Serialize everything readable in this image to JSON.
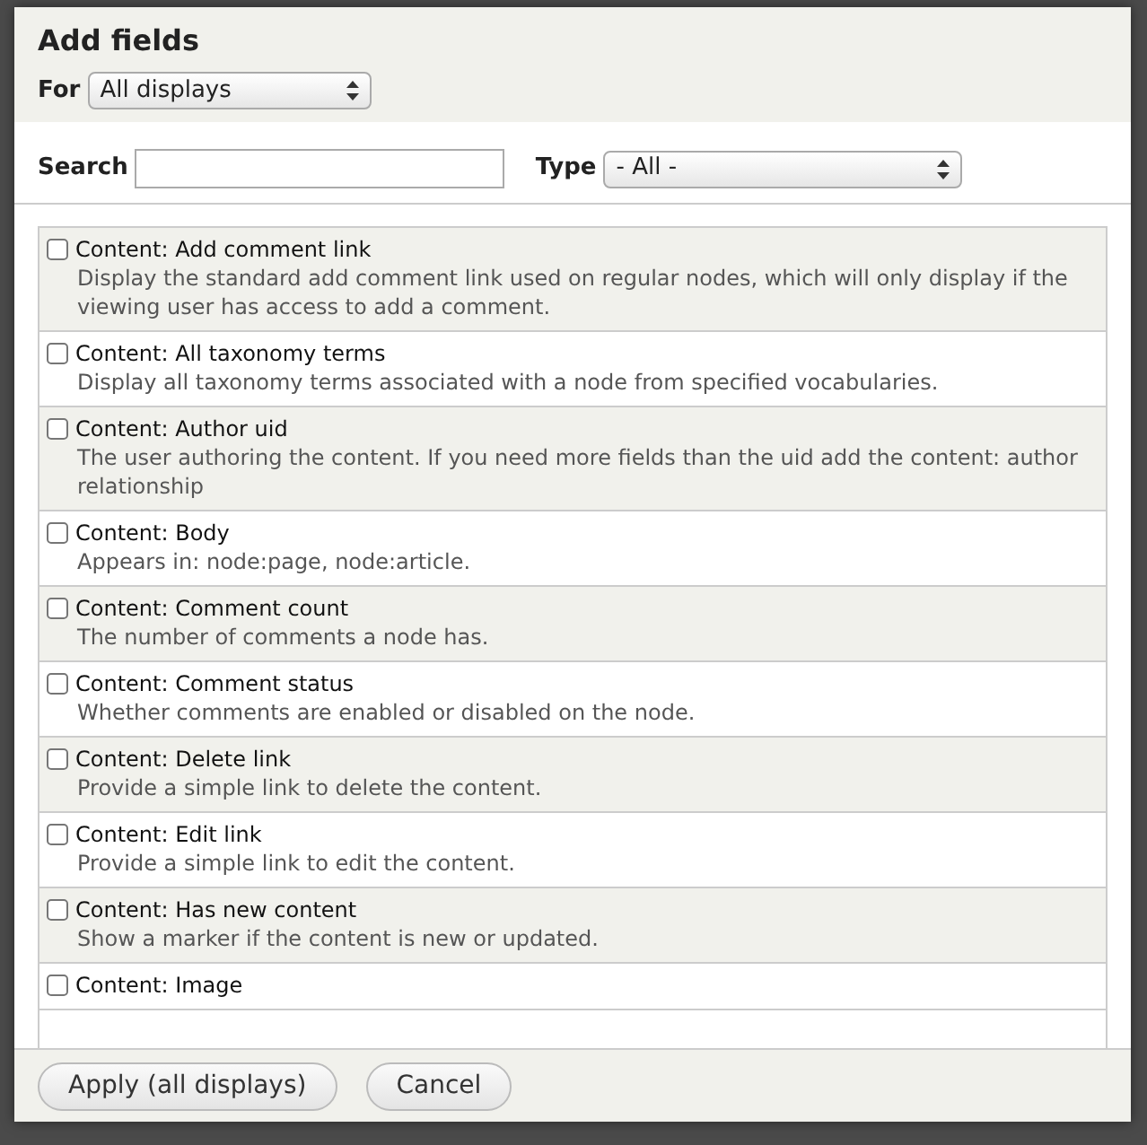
{
  "dialog": {
    "title": "Add fields",
    "for_field": {
      "label": "For",
      "value": "All displays"
    },
    "search_field": {
      "label": "Search"
    },
    "type_field": {
      "label": "Type",
      "value": "- All -"
    },
    "fields": [
      {
        "name": "Content: Add comment link",
        "description": "Display the standard add comment link used on regular nodes, which will only display if the viewing user has access to add a comment.",
        "checked": false
      },
      {
        "name": "Content: All taxonomy terms",
        "description": "Display all taxonomy terms associated with a node from specified vocabularies.",
        "checked": false
      },
      {
        "name": "Content: Author uid",
        "description": "The user authoring the content. If you need more fields than the uid add the content: author relationship",
        "checked": false
      },
      {
        "name": "Content: Body",
        "description": "Appears in: node:page, node:article.",
        "checked": false
      },
      {
        "name": "Content: Comment count",
        "description": "The number of comments a node has.",
        "checked": false
      },
      {
        "name": "Content: Comment status",
        "description": "Whether comments are enabled or disabled on the node.",
        "checked": false
      },
      {
        "name": "Content: Delete link",
        "description": "Provide a simple link to delete the content.",
        "checked": false
      },
      {
        "name": "Content: Edit link",
        "description": "Provide a simple link to edit the content.",
        "checked": false
      },
      {
        "name": "Content: Has new content",
        "description": "Show a marker if the content is new or updated.",
        "checked": false
      },
      {
        "name": "Content: Image",
        "checked": false
      }
    ],
    "buttons": [
      "Apply (all displays)",
      "Cancel"
    ]
  }
}
